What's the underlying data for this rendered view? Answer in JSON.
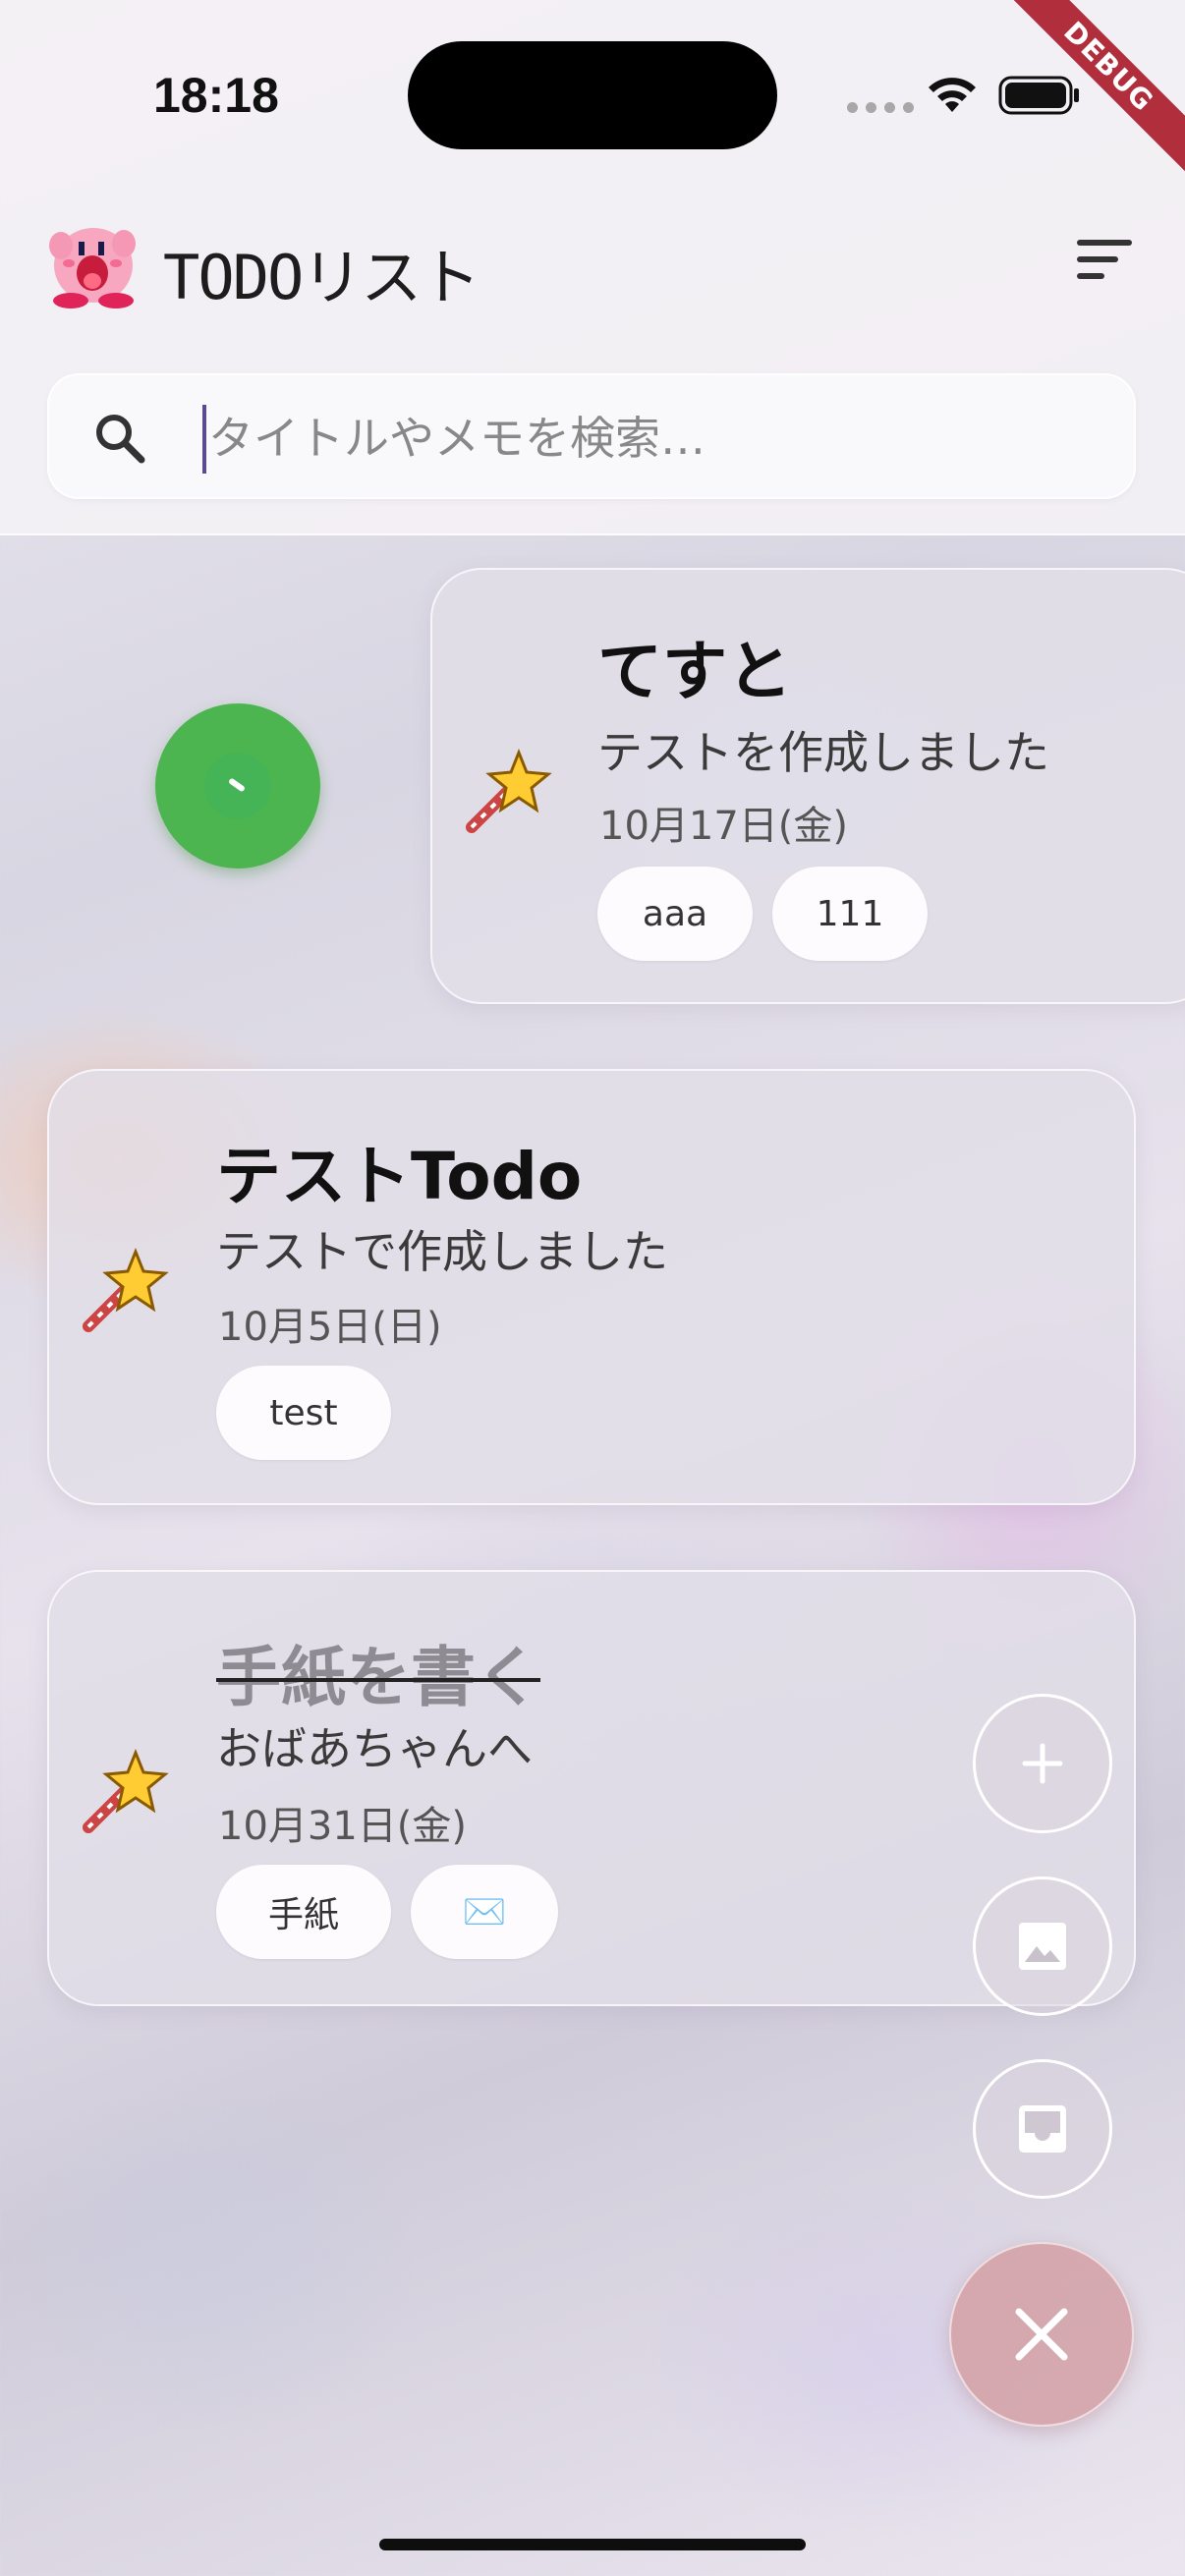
{
  "status_bar": {
    "time": "18:18",
    "debug_label": "DEBUG"
  },
  "header": {
    "title": "TODOリスト",
    "logo_icon": "kirby-icon",
    "sort_icon": "sort-icon",
    "search": {
      "placeholder": "タイトルやメモを検索…",
      "value": ""
    }
  },
  "todos": [
    {
      "title": "てすと",
      "memo": "テストを作成しました",
      "date": "10月17日(金)",
      "tags": [
        "aaa",
        "111"
      ],
      "done": false,
      "icon": "star-wand-icon"
    },
    {
      "title": "テストTodo",
      "memo": "テストで作成しました",
      "date": "10月5日(日)",
      "tags": [
        "test"
      ],
      "done": false,
      "icon": "star-wand-icon"
    },
    {
      "title": "手紙を書く",
      "memo": "おばあちゃんへ",
      "date": "10月31日(金)",
      "tags": [
        "手紙",
        "✉️"
      ],
      "done": true,
      "icon": "star-wand-icon"
    }
  ],
  "fab": {
    "add_icon": "plus-icon",
    "image_icon": "image-icon",
    "inbox_icon": "inbox-icon",
    "close_icon": "close-icon"
  },
  "colors": {
    "accent_green": "#4cb54f",
    "close_fab": "#d4a0a6",
    "cursor": "#5b4a91"
  }
}
